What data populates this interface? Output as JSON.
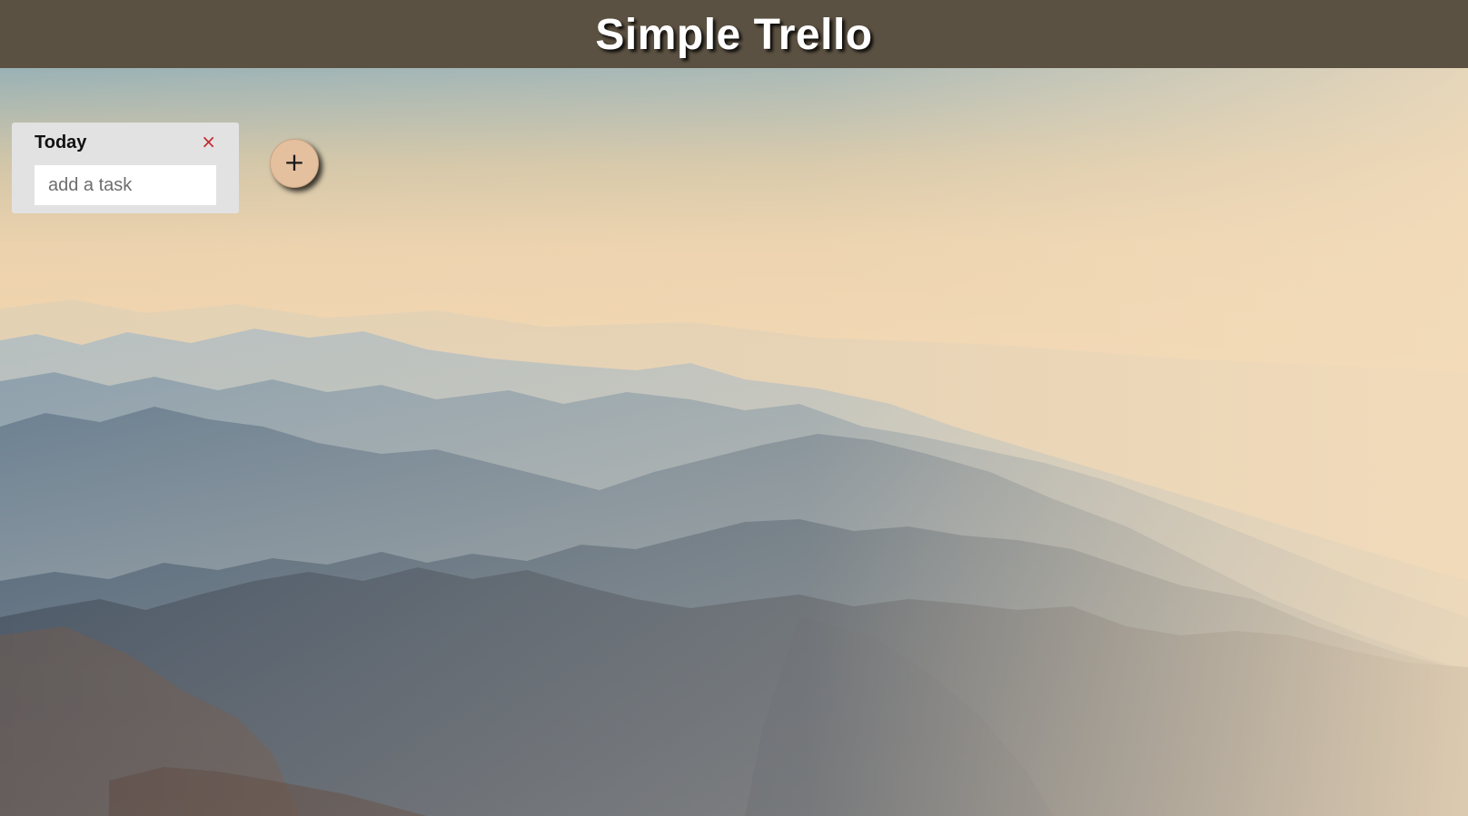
{
  "header": {
    "title": "Simple Trello"
  },
  "board": {
    "lists": [
      {
        "title": "Today",
        "close_label": "×",
        "input_placeholder": "add a task",
        "input_value": ""
      }
    ],
    "add_list_label": "+"
  },
  "colors": {
    "header_bg": "#5b5142",
    "list_bg": "#e2e2e2",
    "close_color": "#c0272d",
    "add_button_bg": "#e5c09f"
  },
  "background": {
    "icon": "mountain-landscape-photo"
  }
}
